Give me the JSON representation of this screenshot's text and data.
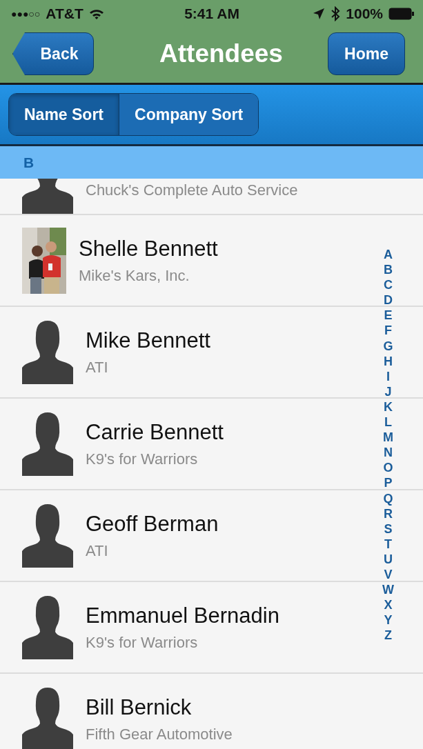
{
  "status_bar": {
    "signal": "●●●○○",
    "carrier": "AT&T",
    "time": "5:41 AM",
    "battery": "100%"
  },
  "nav": {
    "back": "Back",
    "title": "Attendees",
    "home": "Home"
  },
  "sort_tabs": [
    {
      "label": "Name Sort",
      "selected": true
    },
    {
      "label": "Company Sort",
      "selected": false
    }
  ],
  "section": "B",
  "rows": [
    {
      "company": "Chuck's Complete Auto Service",
      "kind": "silhouette"
    },
    {
      "name": "Shelle Bennett",
      "company": "Mike's Kars, Inc.",
      "kind": "picture"
    },
    {
      "name": "Mike Bennett",
      "company": "ATI",
      "kind": "silhouette"
    },
    {
      "name": "Carrie Bennett",
      "company": "K9's for Warriors",
      "kind": "silhouette"
    },
    {
      "name": "Geoff Berman",
      "company": "ATI",
      "kind": "silhouette"
    },
    {
      "name": "Emmanuel Bernadin",
      "company": "K9's for Warriors",
      "kind": "silhouette"
    },
    {
      "name": "Bill Bernick",
      "company": "Fifth Gear Automotive",
      "kind": "silhouette"
    }
  ],
  "index": [
    "A",
    "B",
    "C",
    "D",
    "E",
    "F",
    "G",
    "H",
    "I",
    "J",
    "K",
    "L",
    "M",
    "N",
    "O",
    "P",
    "Q",
    "R",
    "S",
    "T",
    "U",
    "V",
    "W",
    "X",
    "Y",
    "Z"
  ]
}
